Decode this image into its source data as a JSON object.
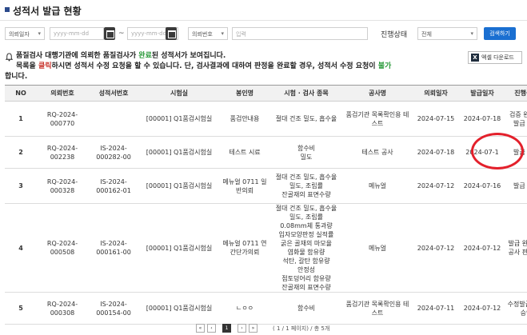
{
  "page": {
    "title": "성적서 발급 현황"
  },
  "filters": {
    "date_type": "의뢰일자",
    "date_from_placeholder": "yyyy-mm-dd",
    "date_to_placeholder": "yyyy-mm-dd",
    "tilde": "~",
    "id_type": "의뢰번호",
    "keyword_placeholder": "입력",
    "status_label": "진행상태",
    "status_value": "전체",
    "search_button": "검색하기"
  },
  "notice": {
    "line1_a": "품질검사 대행기관에 의뢰한 품질검사가 ",
    "line1_b": "완료",
    "line1_c": "된 성적서가 보여집니다.",
    "line2_a": "목록을 ",
    "line2_b": "클릭",
    "line2_c": "하시면 성적서 수정 요청을 할 수 있습니다. 단, 검사결과에 대하여 판정을 완료할 경우, 성적서 수정 요청이 ",
    "line2_d": "불가",
    "line3": "합니다."
  },
  "excel_button": "엑셀 다운로드",
  "table": {
    "headers": [
      "NO",
      "의뢰번호",
      "성적서번호",
      "시험실",
      "봉인명",
      "시험 · 검사 종목",
      "공사명",
      "의뢰일자",
      "발급일자",
      "진행상태"
    ],
    "rows": [
      {
        "no": "1",
        "req": "RQ-2024-000770",
        "cert": "",
        "lab": "[00001] Q1품검시험실",
        "seal": "품검안내용",
        "items": [
          "절대 건조 밀도, 흡수율"
        ],
        "project": "품검기관 목록확인용 테스트",
        "req_date": "2024-07-15",
        "issue_date": "2024-07-18",
        "status": "검증 완료 및 발급 대기"
      },
      {
        "no": "2",
        "req": "RQ-2024-002238",
        "cert": "IS-2024-000282-00",
        "lab": "[00001] Q1품검시험실",
        "seal": "테스트 시료",
        "items": [
          "함수비",
          "밀도"
        ],
        "project": "테스트 공사",
        "req_date": "2024-07-18",
        "issue_date": "2024-07-1",
        "status": "발급 완료"
      },
      {
        "no": "3",
        "req": "RQ-2024-000328",
        "cert": "IS-2024-000162-01",
        "lab": "[00001] Q1품검시험실",
        "seal": "메뉴얼 0711 일반의뢰",
        "items": [
          "절대 건조 밀도, 흡수율",
          "밀도, 조립률",
          "잔골재의 표면수량"
        ],
        "project": "메뉴얼",
        "req_date": "2024-07-12",
        "issue_date": "2024-07-16",
        "status": "발급 완료"
      },
      {
        "no": "4",
        "req": "RQ-2024-000508",
        "cert": "IS-2024-000161-00",
        "lab": "[00001] Q1품검시험실",
        "seal": "메뉴얼 0711 연간단가의뢰",
        "items": [
          "절대 건조 밀도, 흡수율",
          "밀도, 조립률",
          "0.08mm체 통과량",
          "입자모양판정 실적률",
          "굵은 골재의 마모율",
          "염화물 함유량",
          "석탄, 갈탄 함유량",
          "안정성",
          "점토덩어리 함유량",
          "잔골재의 표면수량"
        ],
        "project": "메뉴얼",
        "req_date": "2024-07-12",
        "issue_date": "2024-07-12",
        "status": "발급 완료 (시공사 판정 전)"
      },
      {
        "no": "5",
        "req": "RQ-2024-000308",
        "cert": "IS-2024-000154-00",
        "lab": "[00001] Q1품검시험실",
        "seal": "ㄴㅇㅇ",
        "items": [
          "함수비"
        ],
        "project": "품검기관 목록확인용 테스트",
        "req_date": "2024-07-11",
        "issue_date": "2024-07-12",
        "status": "수정발급 요청 승인"
      }
    ]
  },
  "pager": {
    "first": "«",
    "prev": "‹",
    "current": "1",
    "next": "›",
    "last": "»",
    "info": "( 1 / 1 페이지) / 총 5개"
  },
  "colors": {
    "accent": "#1a6fd1",
    "highlight_circle": "#e3202b",
    "green": "#2a9a3a",
    "red": "#c8322a"
  }
}
